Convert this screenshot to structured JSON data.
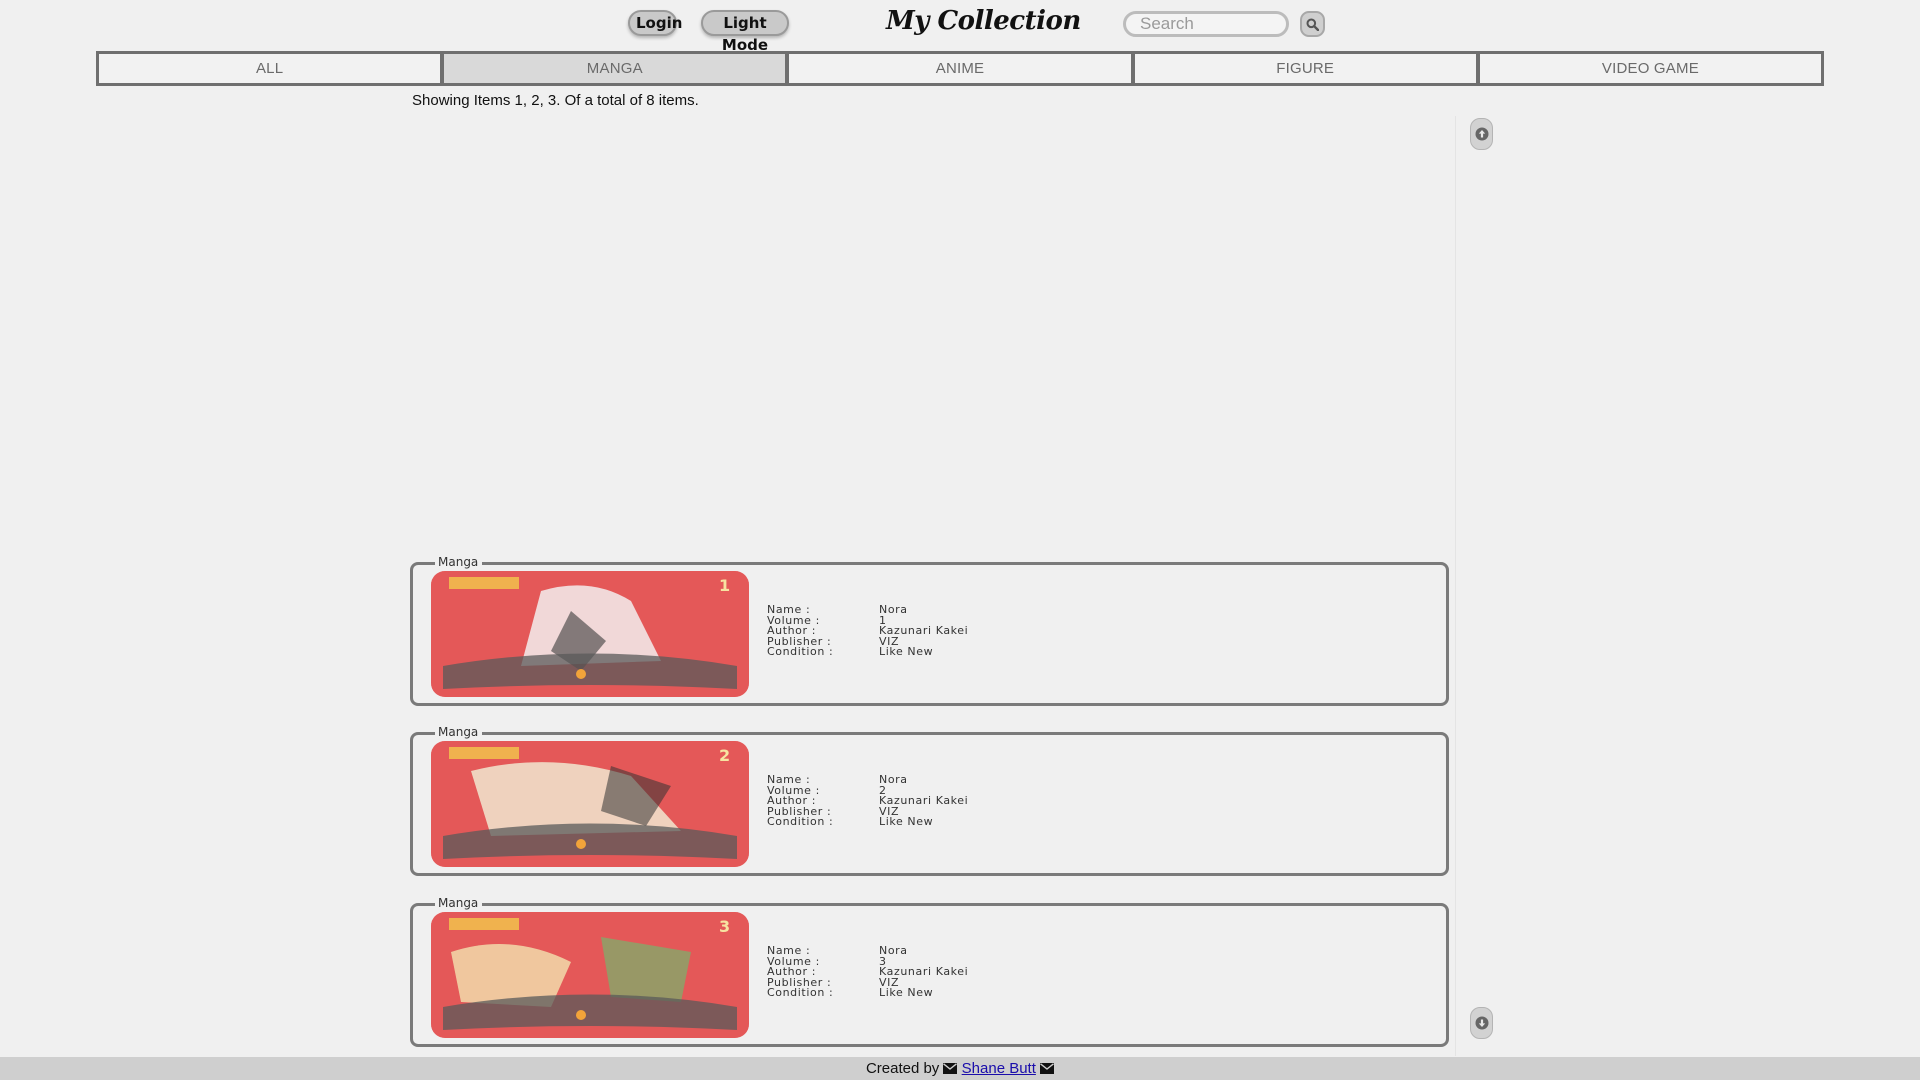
{
  "header": {
    "login_label": "Login",
    "mode_label": "Light Mode",
    "title": "My Collection",
    "search_placeholder": "Search"
  },
  "tabs": [
    {
      "label": "ALL",
      "active": false
    },
    {
      "label": "MANGA",
      "active": true
    },
    {
      "label": "ANIME",
      "active": false
    },
    {
      "label": "FIGURE",
      "active": false
    },
    {
      "label": "VIDEO GAME",
      "active": false
    }
  ],
  "summary": "Showing Items 1, 2, 3. Of a total of 8 items.",
  "field_labels": {
    "name": "Name :",
    "volume": "Volume :",
    "author": "Author :",
    "publisher": "Publisher :",
    "condition": "Condition :"
  },
  "items": [
    {
      "category": "Manga",
      "name": "Nora",
      "volume": "1",
      "author": "Kazunari Kakei",
      "publisher": "VIZ",
      "condition": "Like New",
      "cover_number": "1"
    },
    {
      "category": "Manga",
      "name": "Nora",
      "volume": "2",
      "author": "Kazunari Kakei",
      "publisher": "VIZ",
      "condition": "Like New",
      "cover_number": "2"
    },
    {
      "category": "Manga",
      "name": "Nora",
      "volume": "3",
      "author": "Kazunari Kakei",
      "publisher": "VIZ",
      "condition": "Like New",
      "cover_number": "3"
    }
  ],
  "footer": {
    "created_by": "Created by",
    "author_link": "Shane Butt"
  },
  "icons": {
    "search": "search-icon",
    "scroll_up": "arrow-up-circle-icon",
    "scroll_down": "arrow-down-circle-icon",
    "mail": "envelope-icon"
  },
  "colors": {
    "background": "#f0f0f0",
    "cover_red": "#e75c5c",
    "link": "#1a0dab"
  }
}
